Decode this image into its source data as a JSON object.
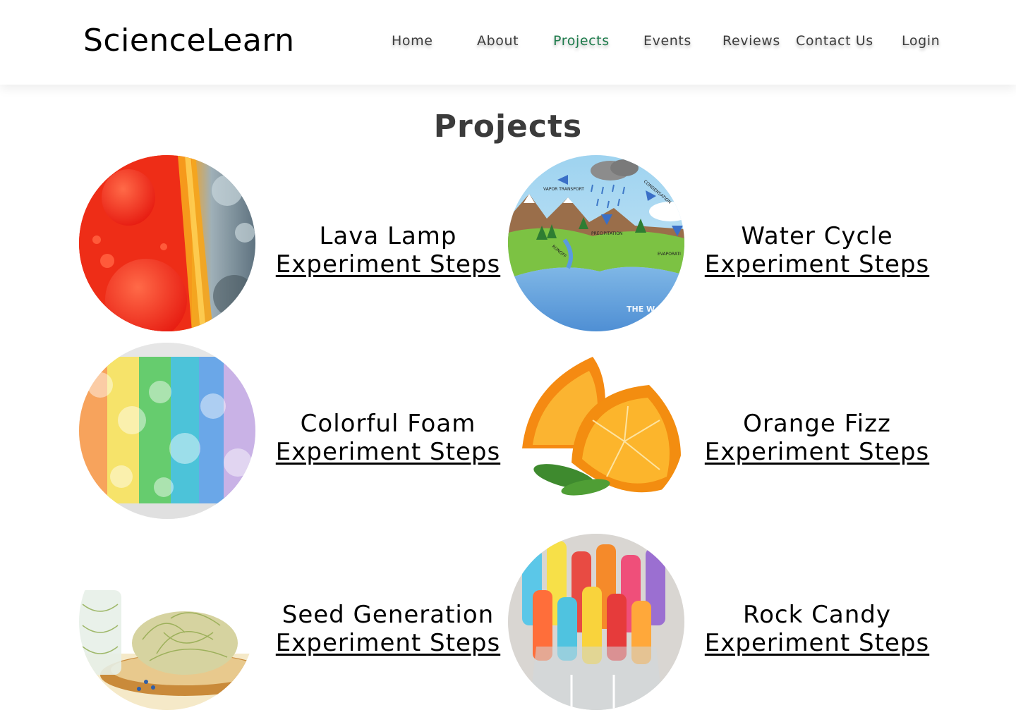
{
  "header": {
    "brand": "ScienceLearn",
    "nav": [
      {
        "label": "Home"
      },
      {
        "label": "About"
      },
      {
        "label": "Projects",
        "active": true
      },
      {
        "label": "Events"
      },
      {
        "label": "Reviews"
      },
      {
        "label": "Contact Us"
      },
      {
        "label": "Login"
      }
    ]
  },
  "main": {
    "title": "Projects",
    "projects": [
      {
        "title": "Lava Lamp",
        "link": "Experiment Steps",
        "image": "lava-lamp"
      },
      {
        "title": "Water Cycle",
        "link": "Experiment Steps",
        "image": "water-cycle-diagram"
      },
      {
        "title": "Colorful Foam",
        "link": "Experiment Steps",
        "image": "rainbow-foam"
      },
      {
        "title": "Orange Fizz",
        "link": "Experiment Steps",
        "image": "orange-slices"
      },
      {
        "title": "Seed Generation",
        "link": "Experiment Steps",
        "image": "sprouts"
      },
      {
        "title": "Rock Candy",
        "link": "Experiment Steps",
        "image": "rock-candy"
      }
    ]
  },
  "diagram_labels": {
    "vapor": "VAPOR TRANSPORT",
    "condensation": "CONDENSATION",
    "precipitation": "PRECIPITATION",
    "runoff": "RUNOFF",
    "evaporation": "EVAPORATI",
    "the_w": "THE W"
  },
  "colors": {
    "accent": "#1d7b4b",
    "nav_text": "#3d3d3d",
    "title_text": "#3b3b3b"
  }
}
